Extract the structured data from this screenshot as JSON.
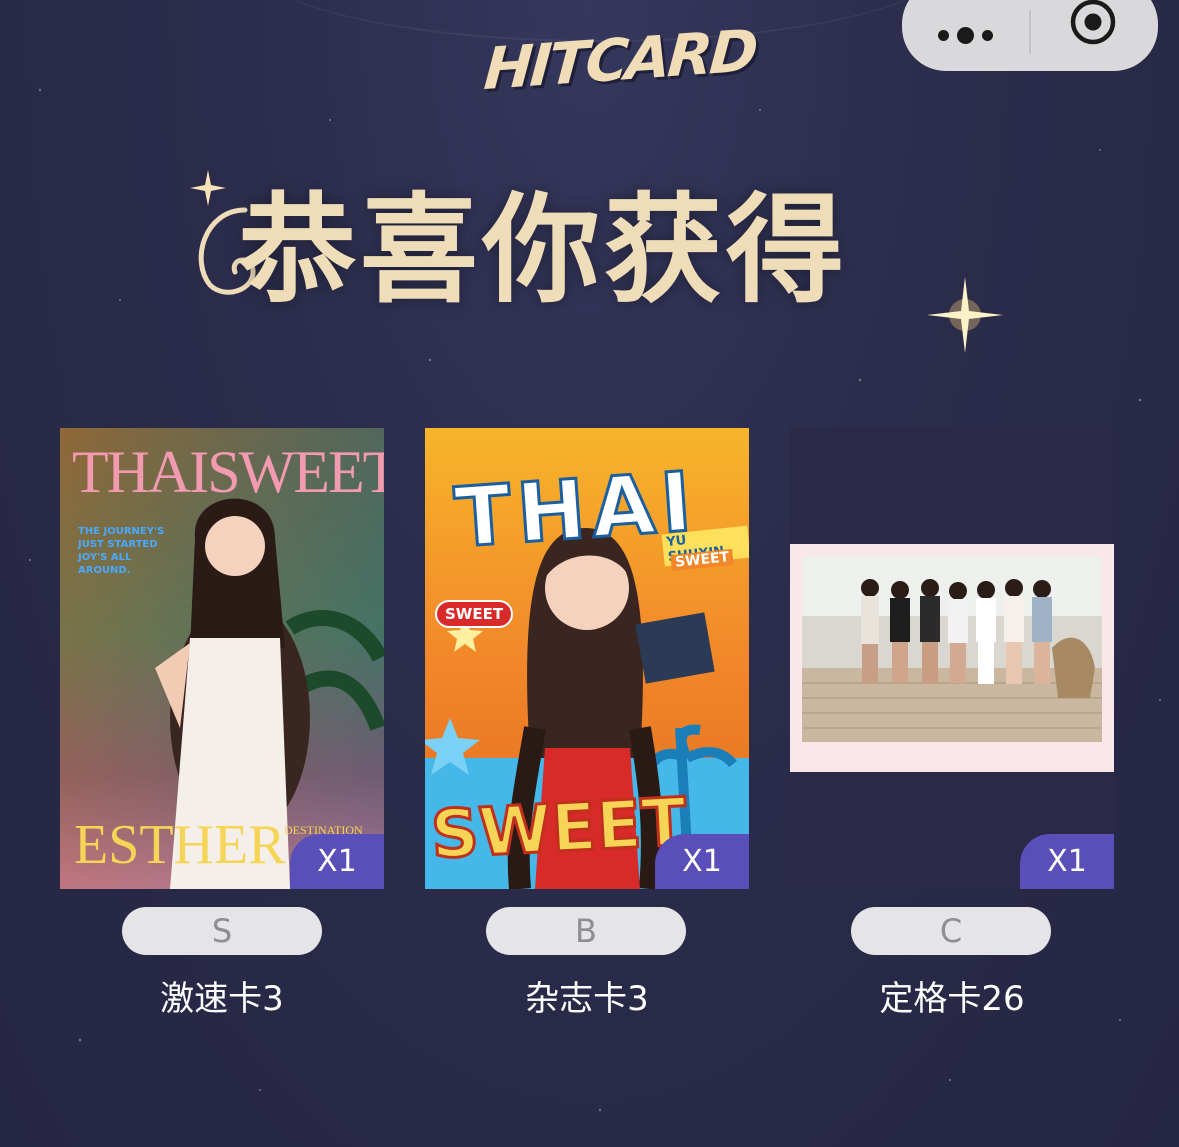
{
  "logo": {
    "text": "HITCARD"
  },
  "headline": "恭喜你获得",
  "cards": [
    {
      "cover_title": "THAISWEET",
      "cover_blurb": "THE JOURNEY'S JUST STARTED JOY'S ALL AROUND.",
      "cover_name": "ESTHER",
      "cover_tag": "DESTINATION",
      "quantity": "X1",
      "grade": "S",
      "name": "激速卡3"
    },
    {
      "cover_title": "THAI",
      "cover_subtitle": "YU SHUXIN",
      "cover_tag_small": "SWEET",
      "cover_sticker": "SWEET",
      "cover_big": "SWEET",
      "quantity": "X1",
      "grade": "B",
      "name": "杂志卡3"
    },
    {
      "quantity": "X1",
      "grade": "C",
      "name": "定格卡26"
    }
  ],
  "colors": {
    "background": "#2b2c4b",
    "accent_gold": "#efdcb9",
    "badge": "#5a4fb8",
    "pill": "#e5e5e8"
  }
}
